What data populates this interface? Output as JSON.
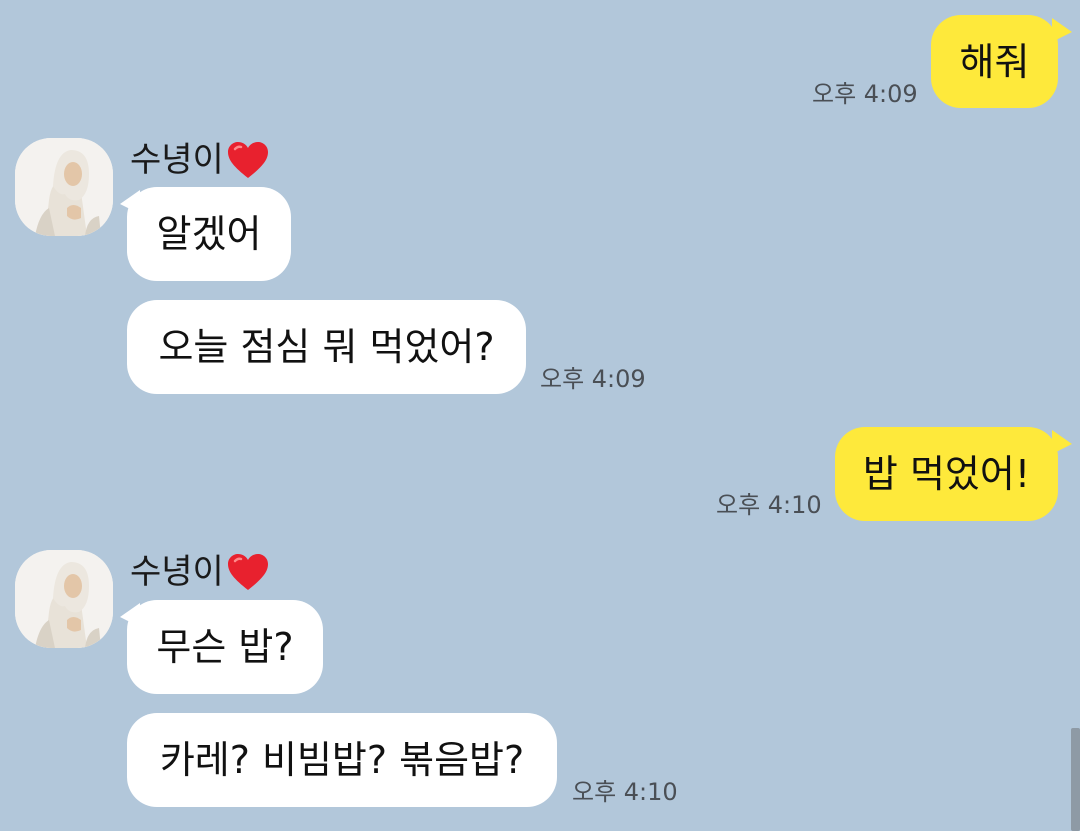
{
  "messages": [
    {
      "side": "right",
      "text": "해줘",
      "time": "오후 4:09"
    },
    {
      "side": "left",
      "sender": "수녕이",
      "text": "알겠어"
    },
    {
      "side": "left",
      "text": "오늘 점심 뭐 먹었어?",
      "time": "오후 4:09"
    },
    {
      "side": "right",
      "text": "밥 먹었어!",
      "time": "오후 4:10"
    },
    {
      "side": "left",
      "sender": "수녕이",
      "text": "무슨 밥?"
    },
    {
      "side": "left",
      "text": "카레? 비빔밥? 볶음밥?",
      "time": "오후 4:10"
    }
  ],
  "icons": {
    "heart": "heart-emoji",
    "avatar": "profile-avatar"
  },
  "colors": {
    "background": "#b2c7da",
    "my_bubble": "#fee93b",
    "their_bubble": "#ffffff",
    "heart": "#e8212e"
  }
}
